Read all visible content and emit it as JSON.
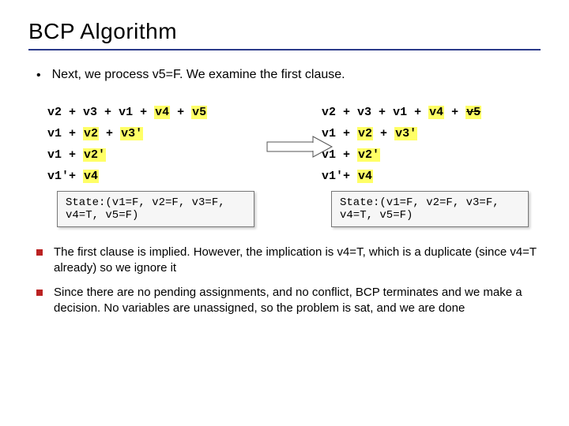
{
  "title": "BCP Algorithm",
  "intro": "Next, we process v5=F. We examine the first clause.",
  "left": {
    "c1": {
      "a": "v2",
      "b": "v3",
      "c": "v1",
      "d": "v4",
      "e": "v5"
    },
    "c2": {
      "a": "v1",
      "b": "v2",
      "c": "v3'"
    },
    "c3": {
      "a": "v1",
      "b": "v2'"
    },
    "c4": {
      "a": "v1'",
      "b": "v4"
    },
    "state": "State:(v1=F, v2=F, v3=F, v4=T, v5=F)"
  },
  "right": {
    "c1": {
      "a": "v2",
      "b": "v3",
      "c": "v1",
      "d": "v4",
      "e": "v5"
    },
    "c2": {
      "a": "v1",
      "b": "v2",
      "c": "v3'"
    },
    "c3": {
      "a": "v1",
      "b": "v2'"
    },
    "c4": {
      "a": "v1'",
      "b": "v4"
    },
    "state": "State:(v1=F, v2=F, v3=F, v4=T, v5=F)"
  },
  "note1": "The first clause is implied. However, the implication is v4=T, which is a duplicate (since v4=T already) so we ignore it",
  "note2": "Since there are no pending assignments, and no conflict, BCP terminates and we make a decision. No variables are unassigned, so the problem is sat, and we are done",
  "plus": " + "
}
